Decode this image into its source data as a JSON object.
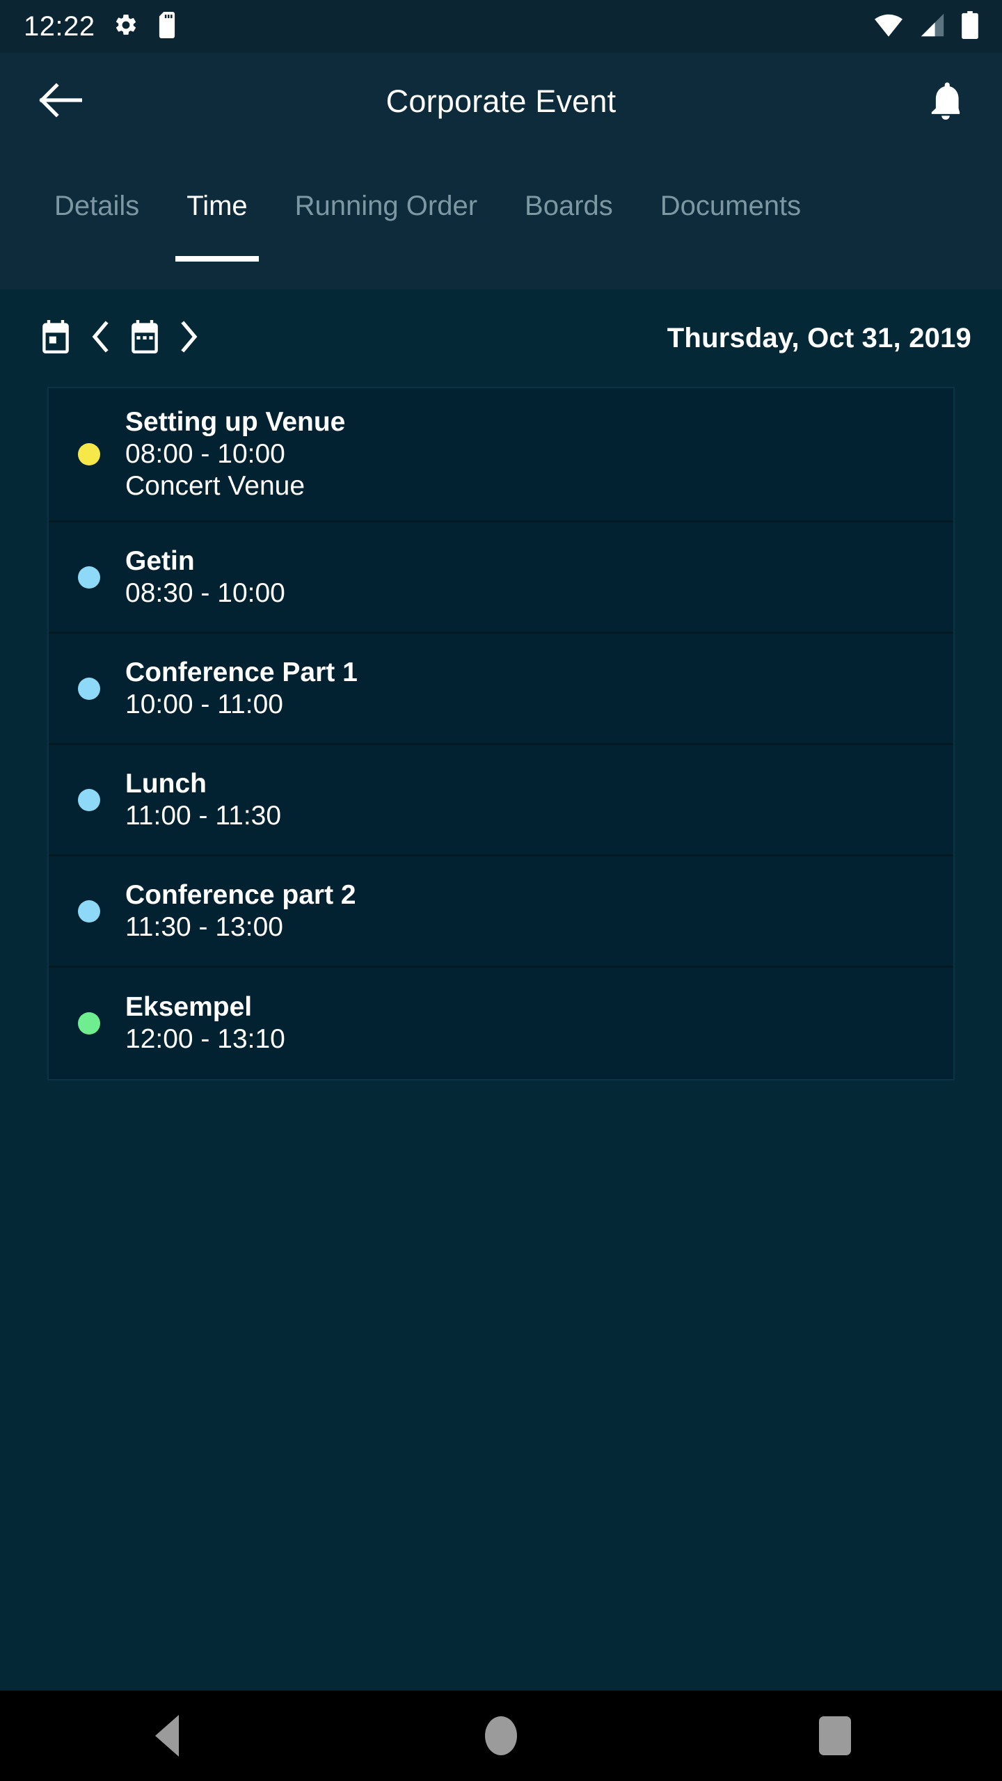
{
  "statusbar": {
    "clock": "12:22",
    "left_icons": [
      "gear-icon",
      "sd-card-icon"
    ],
    "right_icons": [
      "wifi-icon",
      "cell-signal-icon",
      "battery-icon"
    ]
  },
  "header": {
    "back_icon": "arrow-left-icon",
    "title": "Corporate Event",
    "notification_icon": "bell-icon"
  },
  "tabs": {
    "active_index": 1,
    "items": [
      {
        "label": "Details"
      },
      {
        "label": "Time"
      },
      {
        "label": "Running Order"
      },
      {
        "label": "Boards"
      },
      {
        "label": "Documents"
      }
    ]
  },
  "datebar": {
    "today_icon": "calendar-today-icon",
    "prev_icon": "chevron-left-icon",
    "picker_icon": "calendar-picker-icon",
    "next_icon": "chevron-right-icon",
    "date": "Thursday, Oct 31, 2019"
  },
  "agenda": {
    "events": [
      {
        "title": "Setting up Venue",
        "time": "08:00 - 10:00",
        "location": "Concert Venue",
        "color": "#f7e84a"
      },
      {
        "title": "Getin",
        "time": "08:30 - 10:00",
        "location": "",
        "color": "#8ed8f8"
      },
      {
        "title": "Conference Part 1",
        "time": "10:00 - 11:00",
        "location": "",
        "color": "#8ed8f8"
      },
      {
        "title": "Lunch",
        "time": "11:00 - 11:30",
        "location": "",
        "color": "#8ed8f8"
      },
      {
        "title": "Conference part 2",
        "time": "11:30 - 13:00",
        "location": "",
        "color": "#8ed8f8"
      },
      {
        "title": "Eksempel",
        "time": "12:00 - 13:10",
        "location": "",
        "color": "#6fee8f"
      }
    ]
  },
  "navbar": {
    "back_label": "Back",
    "home_label": "Home",
    "recents_label": "Recents"
  },
  "colors": {
    "appbar_bg": "#0d2b3a",
    "content_bg": "#042836",
    "card_bg": "#032231",
    "accent_white": "#ffffff",
    "tab_inactive": "#7d97a3"
  }
}
